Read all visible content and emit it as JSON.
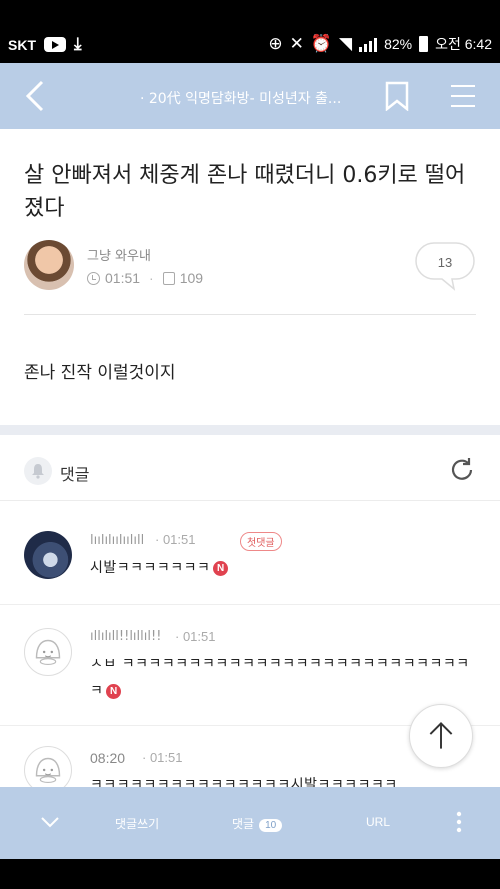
{
  "status_bar": {
    "carrier": "SKT",
    "battery": "82%",
    "time": "오전 6:42"
  },
  "app_bar": {
    "title": "· 20代 익명담화방- 미성년자 출..."
  },
  "post": {
    "title": "살 안빠져서 체중계 존나 때렸더니 0.6키로 떨어졌다",
    "author": "그냥 와우내",
    "time": "01:51",
    "views": "109",
    "comment_count": "13",
    "body": "존나 진작 이럴것이지"
  },
  "comments_section": {
    "label": "댓글",
    "items": [
      {
        "name": "lıılılıılıılıll",
        "time": "01:51",
        "badge": "첫댓글",
        "text": "시발ㅋㅋㅋㅋㅋㅋㅋ",
        "new": "N"
      },
      {
        "name": "ıllılıll!!lıllıl!!",
        "time": "01:51",
        "text": "ㅅㅂ ㅋㅋㅋㅋㅋㅋㅋㅋㅋㅋㅋㅋㅋㅋㅋㅋㅋㅋㅋㅋㅋㅋㅋㅋㅋㅋㅋ",
        "new": "N"
      },
      {
        "name": "08:20",
        "time": "01:51",
        "text": "ㅋㅋㅋㅋㅋㅋㅋㅋㅋㅋㅋㅋㅋㅋㅋ시발ㅋㅋㅋㅋㅋㅋ"
      }
    ]
  },
  "bottom_bar": {
    "write_comment": "댓글쓰기",
    "comments_label": "댓글",
    "comments_count": "10",
    "url": "URL"
  },
  "colors": {
    "accent_bar": "#b9cde6",
    "new_badge": "#e0424f"
  }
}
